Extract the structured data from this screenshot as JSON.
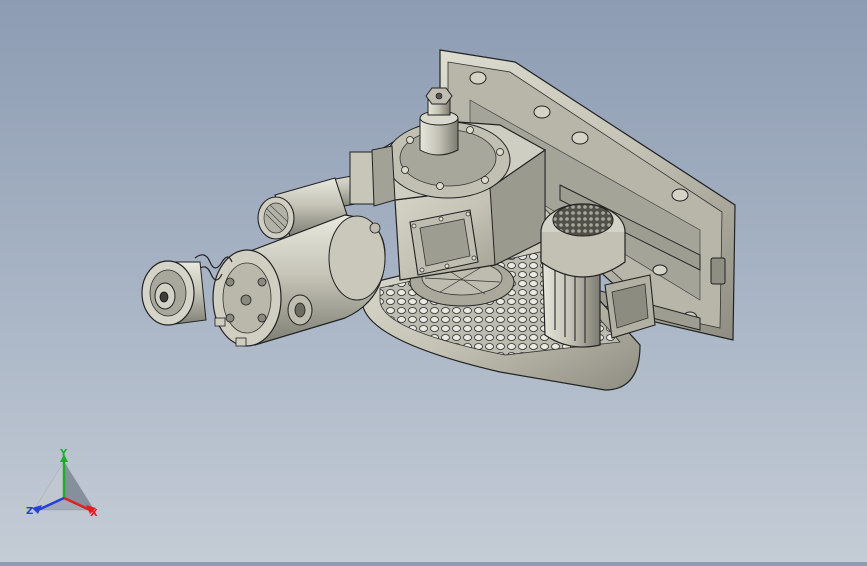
{
  "triad": {
    "x_label": "X",
    "y_label": "Y",
    "z_label": "Z",
    "colors": {
      "x": "#e02020",
      "y": "#1fae2a",
      "z": "#2440d8"
    }
  },
  "model_colors": {
    "body": "#c9c8ba",
    "shade": "#8f8e82",
    "dark": "#4a4a44",
    "edge": "#202020"
  }
}
